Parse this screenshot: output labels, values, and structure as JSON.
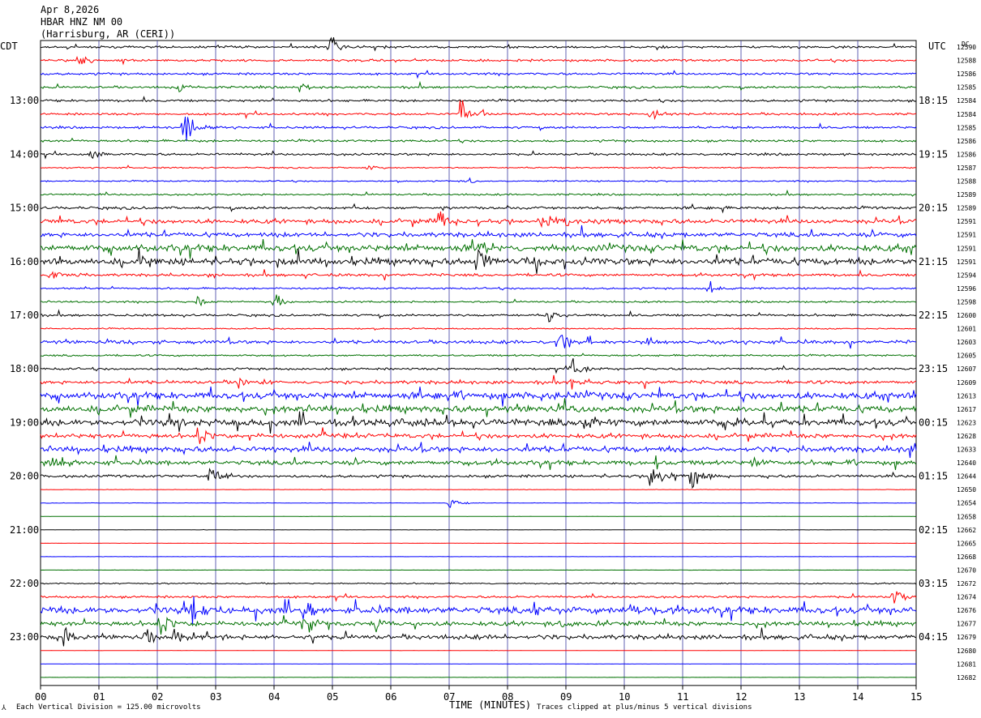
{
  "header": {
    "date": "Apr 8,2026",
    "station": "HBAR HNZ NM 00",
    "location": "(Harrisburg, AR (CERI))"
  },
  "left_tz": "CDT",
  "right_tz": "UTC",
  "dc_header": "DC",
  "footer": {
    "xlabel": "TIME (MINUTES)",
    "scale_note": "Each Vertical Division =  125.00 microvolts",
    "clip_note": "Traces clipped at plus/minus 5 vertical divisions",
    "scale_mark": "⅄"
  },
  "colors": {
    "trace_cycle": [
      "#000000",
      "#ff0000",
      "#0000ff",
      "#007000"
    ],
    "grid": "#3a3aa0",
    "axis": "#000000"
  },
  "chart_data": {
    "type": "line",
    "title": "HBAR HNZ NM 00",
    "xlabel": "TIME (MINUTES)",
    "x_ticks": [
      "00",
      "01",
      "02",
      "03",
      "04",
      "05",
      "06",
      "07",
      "08",
      "09",
      "10",
      "11",
      "12",
      "13",
      "14",
      "15"
    ],
    "xlim": [
      0,
      15
    ],
    "left_hour_labels": [
      {
        "line": 4,
        "text": "13:00"
      },
      {
        "line": 8,
        "text": "14:00"
      },
      {
        "line": 12,
        "text": "15:00"
      },
      {
        "line": 16,
        "text": "16:00"
      },
      {
        "line": 20,
        "text": "17:00"
      },
      {
        "line": 24,
        "text": "18:00"
      },
      {
        "line": 28,
        "text": "19:00"
      },
      {
        "line": 32,
        "text": "20:00"
      },
      {
        "line": 36,
        "text": "21:00"
      },
      {
        "line": 40,
        "text": "22:00"
      },
      {
        "line": 44,
        "text": "23:00"
      }
    ],
    "right_hour_labels": [
      {
        "line": 4,
        "text": "18:15"
      },
      {
        "line": 8,
        "text": "19:15"
      },
      {
        "line": 12,
        "text": "20:15"
      },
      {
        "line": 16,
        "text": "21:15"
      },
      {
        "line": 20,
        "text": "22:15"
      },
      {
        "line": 24,
        "text": "23:15"
      },
      {
        "line": 28,
        "text": "00:15"
      },
      {
        "line": 32,
        "text": "01:15"
      },
      {
        "line": 36,
        "text": "02:15"
      },
      {
        "line": 40,
        "text": "03:15"
      },
      {
        "line": 44,
        "text": "04:15"
      }
    ],
    "dc_offsets": [
      "12590",
      "12588",
      "12586",
      "12585",
      "12584",
      "12584",
      "12585",
      "12586",
      "12586",
      "12587",
      "12588",
      "12589",
      "12589",
      "12591",
      "12591",
      "12591",
      "12591",
      "12594",
      "12596",
      "12598",
      "12600",
      "12601",
      "12603",
      "12605",
      "12607",
      "12609",
      "12613",
      "12617",
      "12623",
      "12628",
      "12633",
      "12640",
      "12644",
      "12650",
      "12654",
      "12658",
      "12662",
      "12665",
      "12668",
      "12670",
      "12672",
      "12674",
      "12676",
      "12677",
      "12679",
      "12680",
      "12681",
      "12682"
    ],
    "noise_levels": [
      1,
      1,
      1,
      1,
      1,
      1,
      1,
      1,
      1,
      0.6,
      0.6,
      0.8,
      1.2,
      2,
      2,
      3,
      3,
      1.2,
      0.8,
      0.8,
      1,
      0.6,
      1.5,
      0.8,
      1,
      1.5,
      3,
      3,
      3,
      2,
      2.5,
      2,
      1.2,
      0.2,
      0.2,
      0.1,
      0.1,
      0.1,
      0.1,
      0.1,
      0.6,
      1,
      3,
      2,
      2,
      0.1,
      0.1,
      0.1
    ],
    "events": [
      {
        "line": 0,
        "minute": 4.95,
        "amp": 10
      },
      {
        "line": 1,
        "minute": 0.65,
        "amp": 4
      },
      {
        "line": 3,
        "minute": 2.35,
        "amp": 4
      },
      {
        "line": 3,
        "minute": 4.45,
        "amp": 4
      },
      {
        "line": 5,
        "minute": 7.2,
        "amp": 12
      },
      {
        "line": 5,
        "minute": 10.45,
        "amp": 7
      },
      {
        "line": 6,
        "minute": 2.45,
        "amp": 16
      },
      {
        "line": 8,
        "minute": 0.85,
        "amp": 5
      },
      {
        "line": 9,
        "minute": 5.6,
        "amp": 2
      },
      {
        "line": 10,
        "minute": 7.3,
        "amp": 3
      },
      {
        "line": 13,
        "minute": 6.8,
        "amp": 10
      },
      {
        "line": 13,
        "minute": 8.6,
        "amp": 8
      },
      {
        "line": 15,
        "minute": 7.5,
        "amp": 9
      },
      {
        "line": 16,
        "minute": 1.7,
        "amp": 6
      },
      {
        "line": 16,
        "minute": 7.5,
        "amp": 12
      },
      {
        "line": 16,
        "minute": 8.5,
        "amp": 9
      },
      {
        "line": 17,
        "minute": 0.15,
        "amp": 6
      },
      {
        "line": 18,
        "minute": 11.45,
        "amp": 6
      },
      {
        "line": 19,
        "minute": 2.7,
        "amp": 5
      },
      {
        "line": 19,
        "minute": 4.0,
        "amp": 6
      },
      {
        "line": 20,
        "minute": 8.7,
        "amp": 7
      },
      {
        "line": 22,
        "minute": 8.85,
        "amp": 10
      },
      {
        "line": 22,
        "minute": 10.4,
        "amp": 4
      },
      {
        "line": 24,
        "minute": 9.1,
        "amp": 8
      },
      {
        "line": 25,
        "minute": 3.4,
        "amp": 6
      },
      {
        "line": 25,
        "minute": 9.1,
        "amp": 7
      },
      {
        "line": 28,
        "minute": 9.3,
        "amp": 7
      },
      {
        "line": 28,
        "minute": 11.9,
        "amp": 6
      },
      {
        "line": 29,
        "minute": 2.7,
        "amp": 8
      },
      {
        "line": 30,
        "minute": 14.9,
        "amp": 9
      },
      {
        "line": 31,
        "minute": 0.2,
        "amp": 8
      },
      {
        "line": 31,
        "minute": 12.2,
        "amp": 8
      },
      {
        "line": 32,
        "minute": 2.9,
        "amp": 9
      },
      {
        "line": 32,
        "minute": 10.45,
        "amp": 12
      },
      {
        "line": 32,
        "minute": 11.15,
        "amp": 14
      },
      {
        "line": 34,
        "minute": 7.0,
        "amp": 5
      },
      {
        "line": 41,
        "minute": 14.6,
        "amp": 8
      },
      {
        "line": 42,
        "minute": 2.6,
        "amp": 14
      },
      {
        "line": 42,
        "minute": 4.5,
        "amp": 7
      },
      {
        "line": 42,
        "minute": 8.5,
        "amp": 6
      },
      {
        "line": 42,
        "minute": 10.1,
        "amp": 6
      },
      {
        "line": 43,
        "minute": 2.05,
        "amp": 10
      },
      {
        "line": 43,
        "minute": 4.5,
        "amp": 8
      },
      {
        "line": 43,
        "minute": 5.75,
        "amp": 5
      },
      {
        "line": 43,
        "minute": 8.9,
        "amp": 5
      },
      {
        "line": 44,
        "minute": 0.4,
        "amp": 7
      },
      {
        "line": 44,
        "minute": 1.8,
        "amp": 6
      },
      {
        "line": 44,
        "minute": 2.3,
        "amp": 8
      }
    ]
  }
}
